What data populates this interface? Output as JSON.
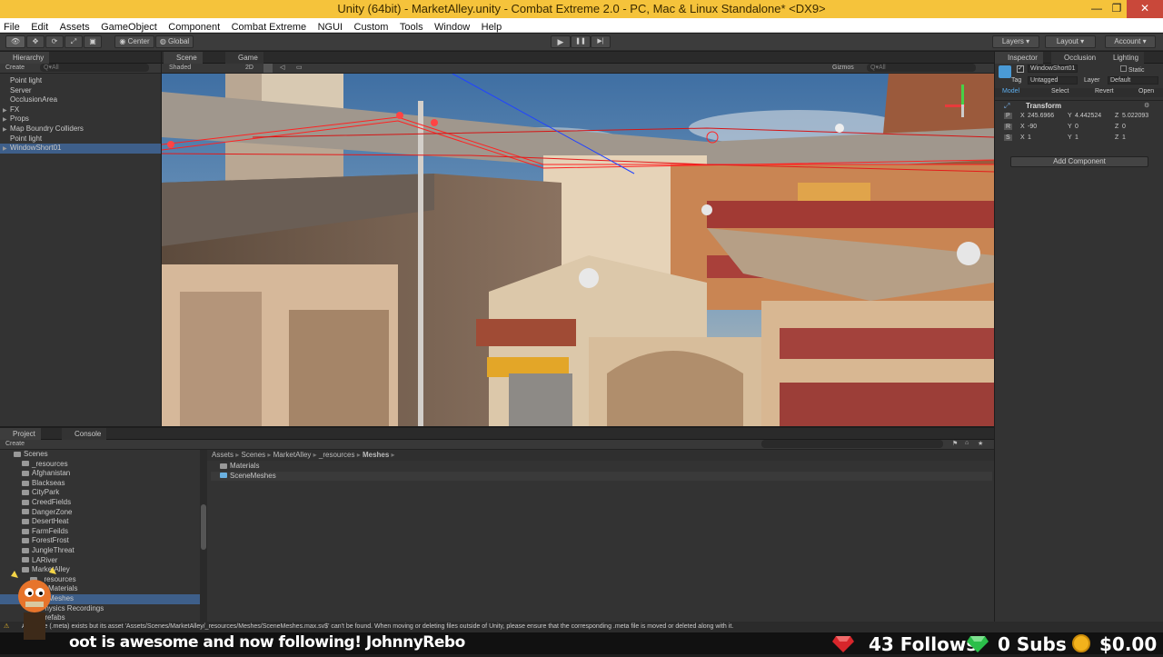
{
  "window": {
    "title": "Unity (64bit) - MarketAlley.unity - Combat Extreme 2.0 - PC, Mac & Linux Standalone* <DX9>",
    "minimize": "—",
    "maximize": "❐",
    "close": "✕"
  },
  "menu": [
    "File",
    "Edit",
    "Assets",
    "GameObject",
    "Component",
    "Combat Extreme",
    "NGUI",
    "Custom",
    "Tools",
    "Window",
    "Help"
  ],
  "toolbar": {
    "center": "Center",
    "global": "Global",
    "play": "▶",
    "pause": "❚❚",
    "step": "▶|",
    "layers": "Layers",
    "layout": "Layout",
    "account": "Account"
  },
  "hierarchy": {
    "tab": "Hierarchy",
    "create": "Create",
    "search": "Q▾All",
    "items": [
      "Point light",
      "Server",
      "OcclusionArea",
      "FX",
      "Props",
      "Map Boundry Colliders",
      "Point light",
      "WindowShort01"
    ],
    "expandable": [
      false,
      false,
      false,
      true,
      true,
      true,
      false,
      true
    ],
    "selected_index": 7
  },
  "scene": {
    "tab": "Scene",
    "game_tab": "Game",
    "shading": "Shaded",
    "mode2d": "2D",
    "gizmos": "Gizmos",
    "search": "Q▾All"
  },
  "inspector": {
    "tab": "Inspector",
    "occlusion": "Occlusion",
    "lighting": "Lighting",
    "object_name": "WindowShort01",
    "static": "Static",
    "tag_label": "Tag",
    "tag_value": "Untagged",
    "layer_label": "Layer",
    "layer_value": "Default",
    "model": "Model",
    "select": "Select",
    "revert": "Revert",
    "open": "Open",
    "transform": "Transform",
    "rows": [
      {
        "label": "P",
        "x": "245.6966",
        "y": "4.442524",
        "z": "5.022093"
      },
      {
        "label": "R",
        "x": "-90",
        "y": "0",
        "z": "0"
      },
      {
        "label": "S",
        "x": "1",
        "y": "1",
        "z": "1"
      }
    ],
    "add_component": "Add Component"
  },
  "project": {
    "tab": "Project",
    "console": "Console",
    "create": "Create",
    "tree": [
      {
        "t": "Scenes",
        "d": 1
      },
      {
        "t": "_resources",
        "d": 2
      },
      {
        "t": "Afghanistan",
        "d": 2
      },
      {
        "t": "Blackseas",
        "d": 2
      },
      {
        "t": "CityPark",
        "d": 2
      },
      {
        "t": "CreedFields",
        "d": 2
      },
      {
        "t": "DangerZone",
        "d": 2
      },
      {
        "t": "DesertHeat",
        "d": 2
      },
      {
        "t": "FarmFeilds",
        "d": 2
      },
      {
        "t": "ForestFrost",
        "d": 2
      },
      {
        "t": "JungleThreat",
        "d": 2
      },
      {
        "t": "LARiver",
        "d": 2
      },
      {
        "t": "MarketAlley",
        "d": 2
      },
      {
        "t": "_resources",
        "d": 3
      },
      {
        "t": "Materials",
        "d": 4
      },
      {
        "t": "Meshes",
        "d": 4
      },
      {
        "t": "Physics Recordings",
        "d": 3
      },
      {
        "t": "Prefabs",
        "d": 3
      }
    ],
    "selected_tree": 15,
    "breadcrumb": [
      "Assets",
      "Scenes",
      "MarketAlley",
      "_resources",
      "Meshes"
    ],
    "files": [
      "Materials",
      "SceneMeshes"
    ]
  },
  "status": "Asset file (.meta) exists but its asset 'Assets/Scenes/MarketAlley/_resources/Meshes/SceneMeshes.max.sv$' can't be found. When moving or deleting files outside of Unity, please ensure that the corresponding .meta file is moved or deleted along with it.",
  "stream": {
    "ticker": "oot is awesome and now following! JohnnyRebo",
    "follows": "43 Follows",
    "subs": "0 Subs",
    "money": "$0.00"
  },
  "colors": {
    "titlebar": "#f5c33b",
    "selection": "#3e5f8a",
    "sky": "#3f6fa3"
  }
}
